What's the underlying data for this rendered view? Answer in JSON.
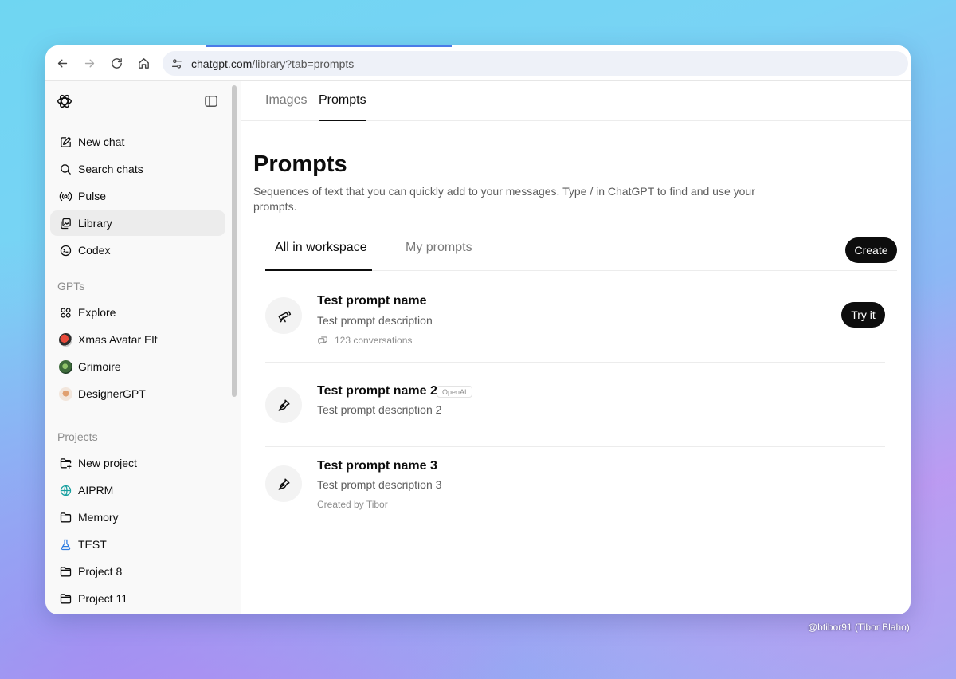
{
  "browser": {
    "url_host": "chatgpt.com",
    "url_path": "/library?tab=prompts"
  },
  "sidebar": {
    "items": [
      {
        "label": "New chat",
        "icon": "compose-icon"
      },
      {
        "label": "Search chats",
        "icon": "search-icon"
      },
      {
        "label": "Pulse",
        "icon": "pulse-icon"
      },
      {
        "label": "Library",
        "icon": "library-icon",
        "active": true
      },
      {
        "label": "Codex",
        "icon": "codex-icon"
      }
    ],
    "gpts_heading": "GPTs",
    "gpts": [
      {
        "label": "Explore",
        "icon": "explore-icon"
      },
      {
        "label": "Xmas Avatar Elf",
        "icon": "xmas-avatar-elf-avatar"
      },
      {
        "label": "Grimoire",
        "icon": "grimoire-avatar"
      },
      {
        "label": "DesignerGPT",
        "icon": "designergpt-avatar"
      }
    ],
    "projects_heading": "Projects",
    "projects": [
      {
        "label": "New project",
        "icon": "folder-plus-icon"
      },
      {
        "label": "AIPRM",
        "icon": "globe-icon"
      },
      {
        "label": "Memory",
        "icon": "folder-icon"
      },
      {
        "label": "TEST",
        "icon": "flask-icon"
      },
      {
        "label": "Project 8",
        "icon": "folder-icon"
      },
      {
        "label": "Project 11",
        "icon": "folder-icon"
      }
    ]
  },
  "library": {
    "tabs": [
      "Images",
      "Prompts"
    ],
    "active_tab": "Prompts",
    "title": "Prompts",
    "description": "Sequences of text that you can quickly add to your messages. Type / in ChatGPT to find and use your prompts.",
    "subtabs": [
      "All in workspace",
      "My prompts"
    ],
    "active_subtab": "All in workspace",
    "create_label": "Create",
    "prompts": [
      {
        "name": "Test prompt name",
        "description": "Test prompt description",
        "meta": "123 conversations",
        "action": "Try it",
        "icon": "telescope-icon"
      },
      {
        "name": "Test prompt name 2",
        "description": "Test prompt description 2",
        "badge": "OpenAI",
        "icon": "pen-nib-icon"
      },
      {
        "name": "Test prompt name 3",
        "description": "Test prompt description 3",
        "meta": "Created by Tibor",
        "icon": "pen-nib-icon"
      }
    ]
  },
  "credit": "@btibor91 (Tibor Blaho)",
  "colors": {
    "accent": "#0d0d0d",
    "active_item_bg": "#ececec",
    "load_bar": "#4a7be8"
  }
}
